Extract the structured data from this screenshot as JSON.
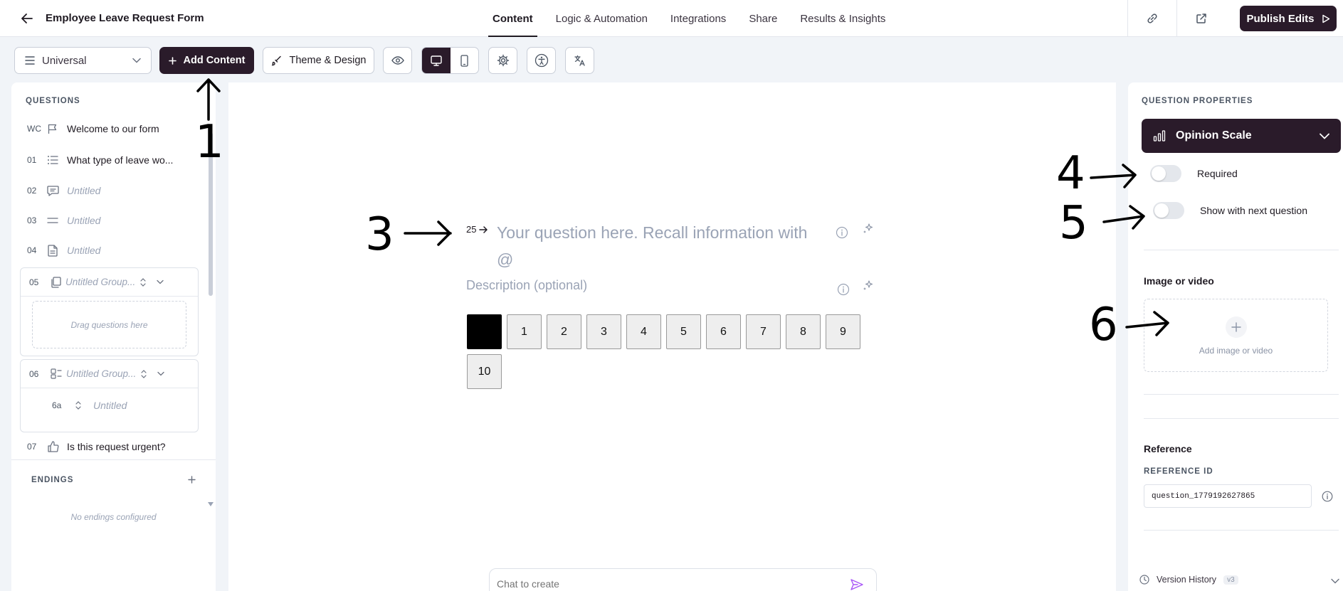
{
  "header": {
    "title": "Employee Leave Request Form",
    "tabs": [
      "Content",
      "Logic & Automation",
      "Integrations",
      "Share",
      "Results & Insights"
    ],
    "active_tab": "Content",
    "publish_label": "Publish Edits"
  },
  "toolbar": {
    "view_select": "Universal",
    "add_content": "Add Content",
    "theme_design": "Theme & Design"
  },
  "questions_panel": {
    "label": "QUESTIONS",
    "items": [
      {
        "num": "WC",
        "icon": "flag-icon",
        "text": "Welcome to our form"
      },
      {
        "num": "01",
        "icon": "list-icon",
        "text": "What type of leave wo..."
      },
      {
        "num": "02",
        "icon": "chat-bubble-icon",
        "text": "Untitled"
      },
      {
        "num": "03",
        "icon": "equals-icon",
        "text": "Untitled"
      },
      {
        "num": "04",
        "icon": "document-icon",
        "text": "Untitled"
      }
    ],
    "group_05": {
      "num": "05",
      "text": "Untitled Group...",
      "drop_hint": "Drag questions here"
    },
    "group_06": {
      "num": "06",
      "text": "Untitled Group...",
      "sub": {
        "num": "6a",
        "text": "Untitled"
      }
    },
    "item_07": {
      "num": "07",
      "icon": "thumbs-up-icon",
      "text": "Is this request urgent?"
    },
    "endings_label": "ENDINGS",
    "no_endings": "No endings configured"
  },
  "canvas": {
    "question_number": "25",
    "question_line1": "Your question here. Recall information with",
    "question_line2": "@",
    "description_placeholder": "Description (optional)",
    "scale": [
      "",
      "1",
      "2",
      "3",
      "4",
      "5",
      "6",
      "7",
      "8",
      "9",
      "10"
    ],
    "chat_placeholder": "Chat to create"
  },
  "properties": {
    "label": "QUESTION PROPERTIES",
    "type": "Opinion Scale",
    "required_label": "Required",
    "show_next_label": "Show with next question",
    "media_heading": "Image or video",
    "media_add": "Add image or video",
    "reference_heading": "Reference",
    "reference_id_label": "REFERENCE ID",
    "reference_id": "question_1779192627865",
    "version_history": "Version History",
    "version_badge": "v3"
  },
  "annotations": [
    "1",
    "3",
    "4",
    "5",
    "6"
  ],
  "colors": {
    "accent": "#2a1b2a",
    "background": "#f1f4f8"
  }
}
